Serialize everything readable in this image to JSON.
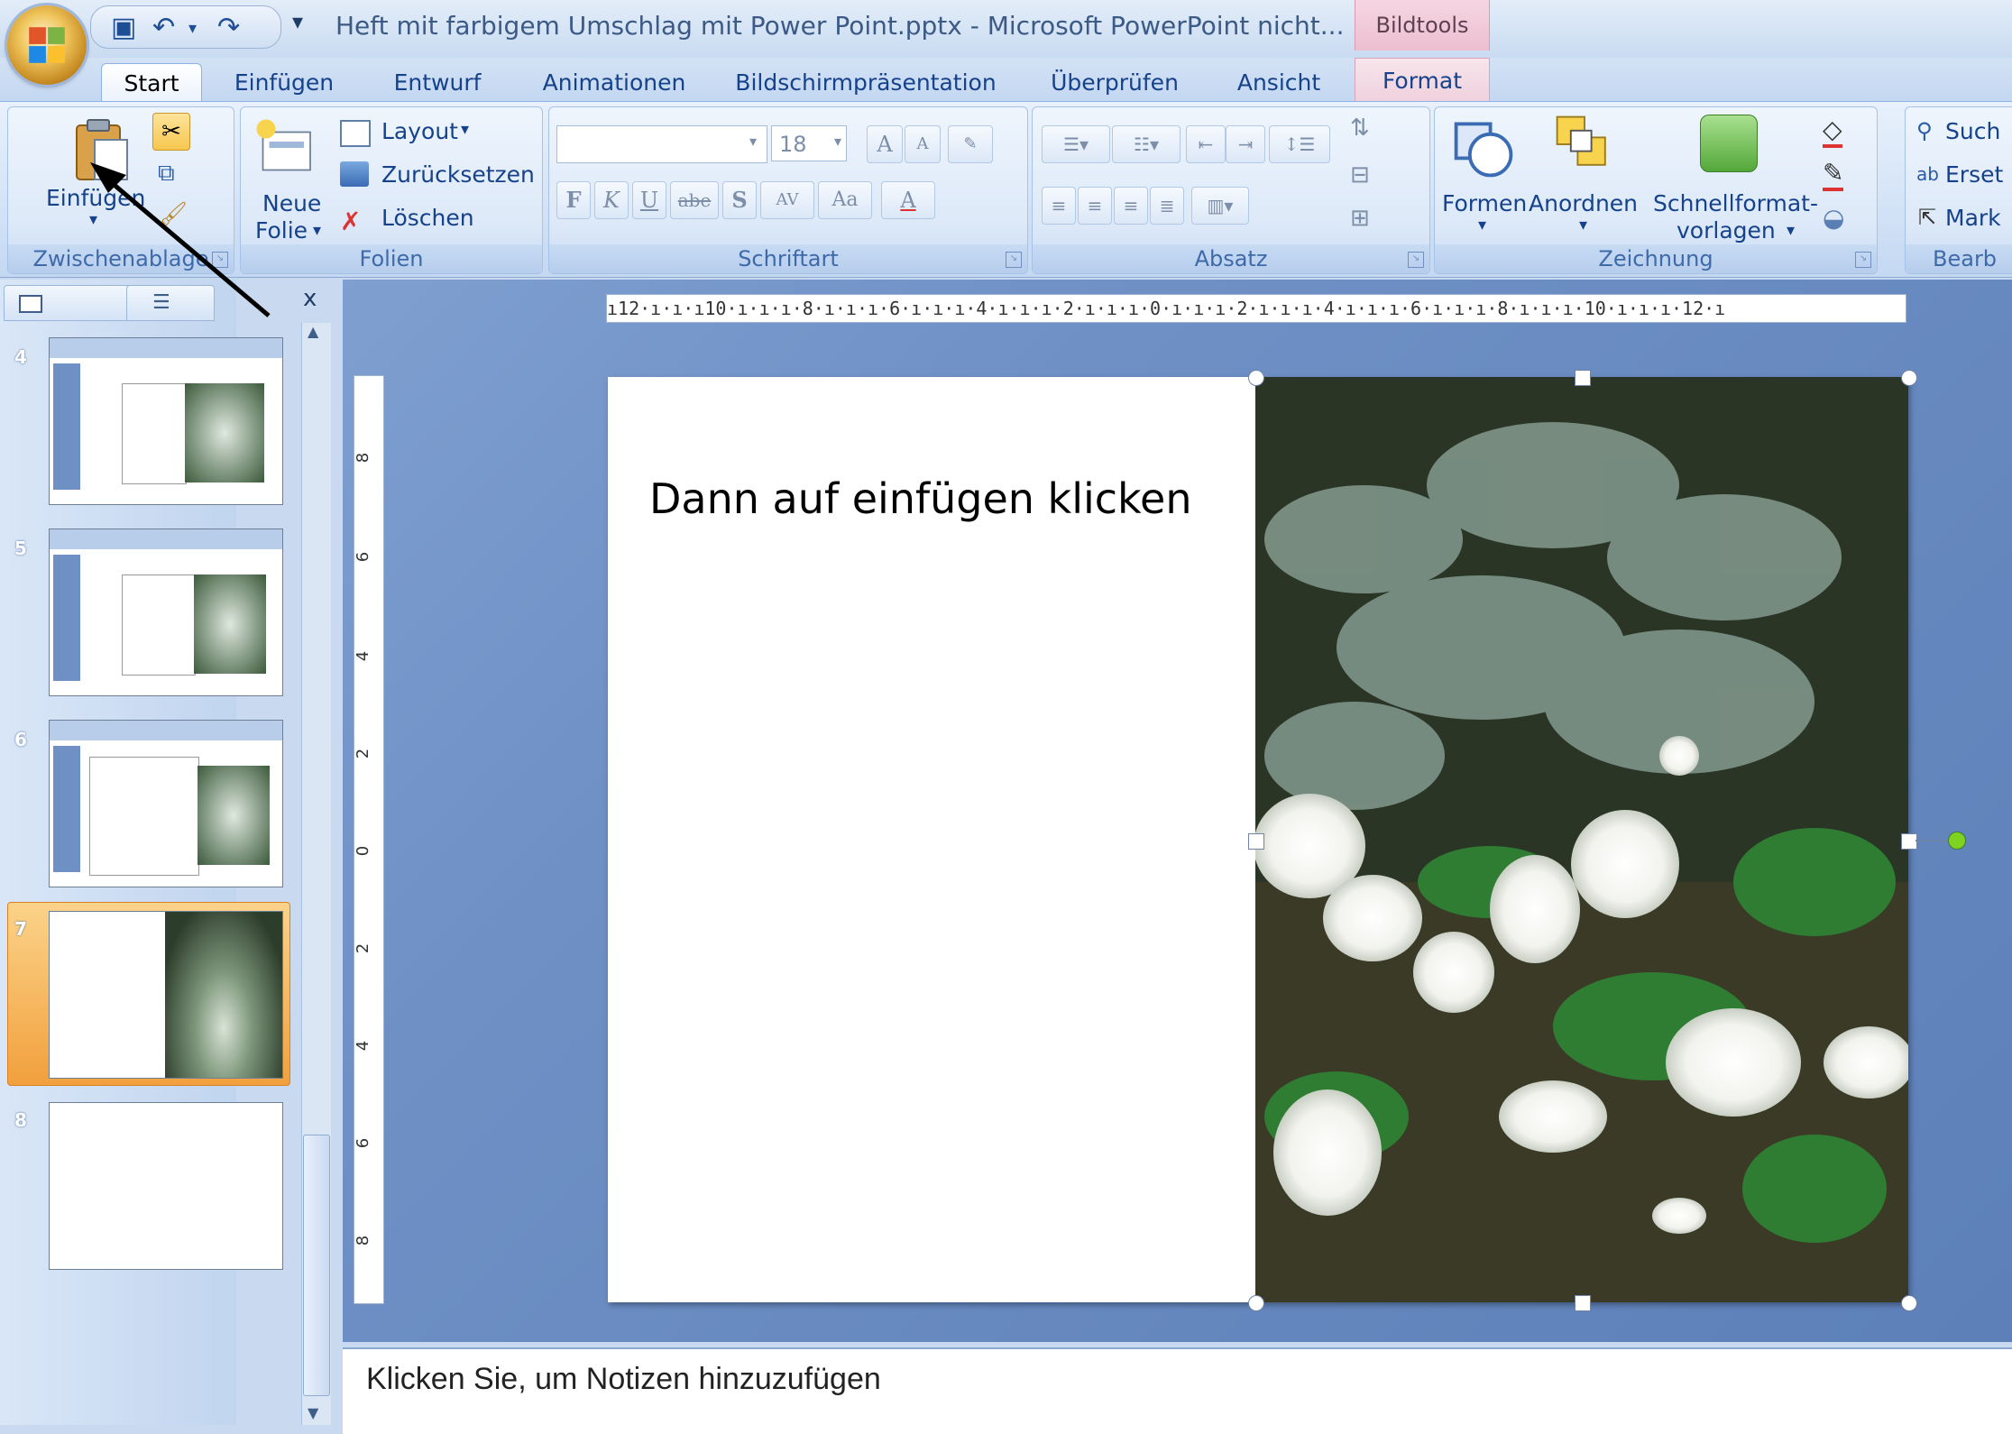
{
  "window": {
    "title": "Heft mit farbigem Umschlag mit Power Point.pptx - Microsoft PowerPoint nicht...",
    "context_tab_group": "Bildtools"
  },
  "quick_access": [
    "save-icon",
    "undo-icon",
    "redo-icon",
    "customize-icon"
  ],
  "tabs": [
    "Start",
    "Einfügen",
    "Entwurf",
    "Animationen",
    "Bildschirmpräsentation",
    "Überprüfen",
    "Ansicht",
    "Format"
  ],
  "active_tab": "Start",
  "ribbon": {
    "zwischenablage": {
      "label": "Zwischenablage",
      "paste": "Einfügen"
    },
    "folien": {
      "label": "Folien",
      "new_slide_1": "Neue",
      "new_slide_2": "Folie",
      "layout": "Layout",
      "reset": "Zurücksetzen",
      "delete": "Löschen"
    },
    "schriftart": {
      "label": "Schriftart",
      "font_size": "18",
      "bold": "F",
      "italic": "K",
      "underline": "U",
      "strike": "abe",
      "shadow": "S",
      "spacing": "AV",
      "case": "Aa",
      "color": "A",
      "grow": "A",
      "shrink": "A"
    },
    "absatz": {
      "label": "Absatz"
    },
    "zeichnung": {
      "label": "Zeichnung",
      "formen": "Formen",
      "anordnen": "Anordnen",
      "schnellformat_1": "Schnellformat-",
      "schnellformat_2": "vorlagen"
    },
    "bearbeiten": {
      "label": "Bearb",
      "suchen": "Such",
      "ersetzen": "Erset",
      "markieren": "Mark"
    }
  },
  "slide_panel": {
    "close": "x",
    "thumbnails": [
      {
        "number": "4"
      },
      {
        "number": "5"
      },
      {
        "number": "6"
      },
      {
        "number": "7",
        "selected": true
      },
      {
        "number": "8"
      }
    ]
  },
  "ruler": {
    "horizontal": "ı12·ı·ı·ı10·ı·ı·ı·8·ı·ı·ı·6·ı·ı·ı·4·ı·ı·ı·2·ı·ı·ı·0·ı·ı·ı·2·ı·ı·ı·4·ı·ı·ı·6·ı·ı·ı·8·ı·ı·ı·10·ı·ı·ı·12·ı",
    "vertical": [
      "8",
      "6",
      "4",
      "2",
      "0",
      "2",
      "4",
      "6",
      "8"
    ]
  },
  "slide": {
    "text": "Dann auf einfügen klicken"
  },
  "notes": {
    "placeholder": "Klicken Sie, um  Notizen hinzuzufügen"
  },
  "colors": {
    "workspace": "#6f90c6",
    "selected_thumb": "#f2a03d",
    "ribbon_text": "#15428b"
  }
}
